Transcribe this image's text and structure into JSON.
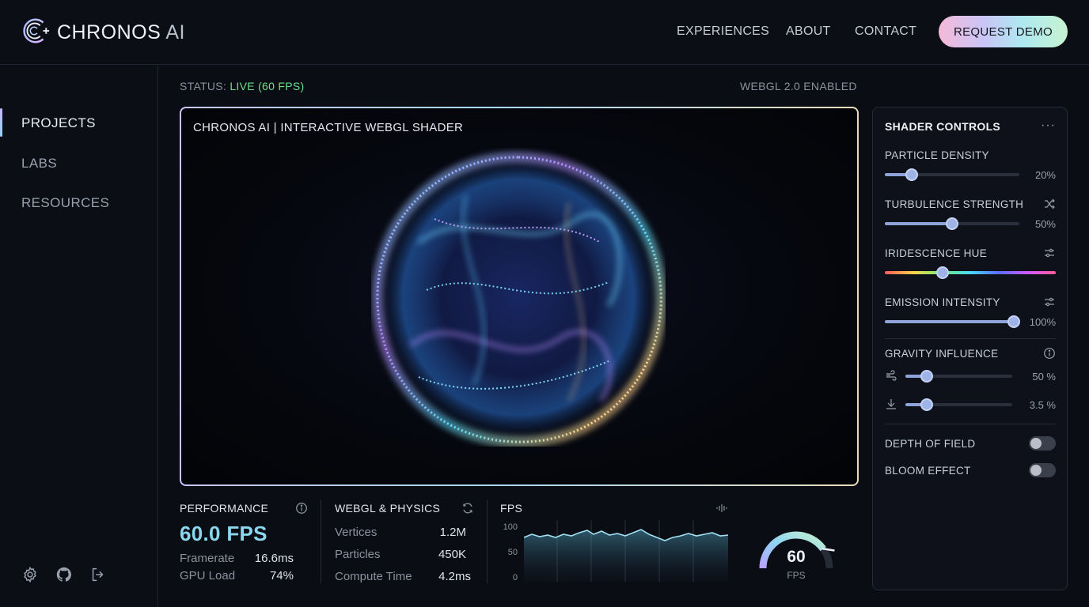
{
  "brand": {
    "name": "CHRONOS",
    "suffix": "AI"
  },
  "nav": {
    "experiences": "EXPERIENCES",
    "about": "ABOUT",
    "contact": "CONTACT",
    "demo": "REQUEST DEMO"
  },
  "sidebar": {
    "items": [
      {
        "label": "PROJECTS",
        "active": true
      },
      {
        "label": "LABS"
      },
      {
        "label": "RESOURCES"
      }
    ],
    "icons": [
      "gear-icon",
      "github-icon",
      "logout-icon"
    ]
  },
  "status": {
    "prefix": "STATUS:",
    "value": "LIVE (60 FPS)",
    "webgl": "WEBGL 2.0 ENABLED"
  },
  "viewport": {
    "title": "CHRONOS AI | INTERACTIVE WEBGL SHADER"
  },
  "performance": {
    "label": "PERFORMANCE",
    "fps": "60.0 FPS",
    "framerate_label": "Framerate",
    "framerate_value": "16.6ms",
    "gpu_label": "GPU Load",
    "gpu_value": "74%"
  },
  "physics": {
    "label": "WEBGL & PHYSICS",
    "vertices_label": "Vertices",
    "vertices_value": "1.2M",
    "particles_label": "Particles",
    "particles_value": "450K",
    "compute_label": "Compute Time",
    "compute_value": "4.2ms"
  },
  "fps_panel": {
    "label": "FPS",
    "y_ticks": [
      "100",
      "50",
      "0"
    ],
    "gauge_value": "60",
    "gauge_unit": "FPS",
    "gauge_fraction": 0.8
  },
  "controls": {
    "title": "SHADER CONTROLS",
    "more": "···",
    "particle_density": {
      "label": "PARTICLE DENSITY",
      "value": 0.2,
      "display": "20%"
    },
    "turbulence": {
      "label": "TURBULENCE STRENGTH",
      "value": 0.5,
      "display": "50%"
    },
    "iridescence": {
      "label": "IRIDESCENCE HUE",
      "value": 0.34
    },
    "emission": {
      "label": "EMISSION INTENSITY",
      "value": 1.0,
      "display": "100%"
    },
    "gravity": {
      "label": "GRAVITY INFLUENCE",
      "wind": {
        "value": 0.2,
        "display": "50 %"
      },
      "down": {
        "value": 0.2,
        "display": "3.5 %"
      }
    },
    "depth_of_field": {
      "label": "DEPTH OF FIELD",
      "on": false
    },
    "bloom": {
      "label": "BLOOM EFFECT",
      "on": false
    }
  },
  "colors": {
    "live": "#6fe08c",
    "fps": "#8ad7ee",
    "accent": "#9fb4e6"
  }
}
